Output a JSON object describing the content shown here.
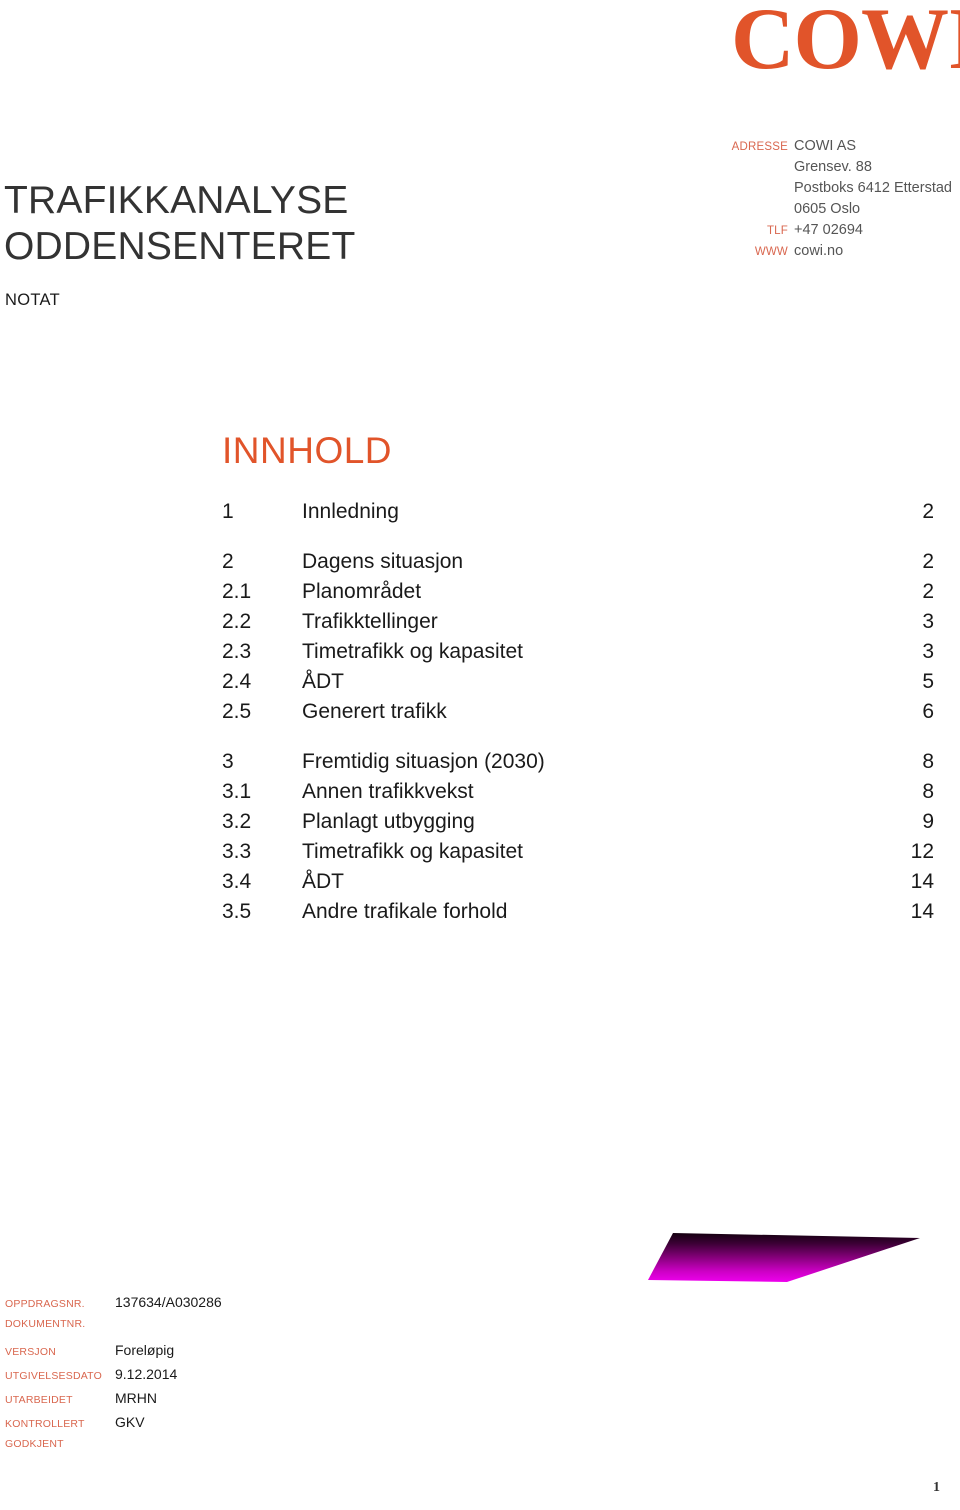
{
  "brand": {
    "logo_text": "COWI",
    "accent_color": "#E1542A",
    "label_color": "#D9674F"
  },
  "address": {
    "rows": [
      {
        "label": "ADRESSE",
        "value": "COWI AS"
      },
      {
        "label": "",
        "value": "Grensev. 88"
      },
      {
        "label": "",
        "value": "Postboks 6412 Etterstad"
      },
      {
        "label": "",
        "value": "0605 Oslo"
      },
      {
        "label": "TLF",
        "value": "+47 02694"
      },
      {
        "label": "WWW",
        "value": "cowi.no"
      }
    ]
  },
  "document": {
    "title_line1": "TRAFIKKANALYSE",
    "title_line2": "ODDENSENTERET",
    "subtitle": "NOTAT"
  },
  "toc": {
    "heading": "INNHOLD",
    "groups": [
      {
        "entries": [
          {
            "number": "1",
            "label": "Innledning",
            "page": "2"
          }
        ]
      },
      {
        "entries": [
          {
            "number": "2",
            "label": "Dagens situasjon",
            "page": "2"
          },
          {
            "number": "2.1",
            "label": "Planområdet",
            "page": "2"
          },
          {
            "number": "2.2",
            "label": "Trafikktellinger",
            "page": "3"
          },
          {
            "number": "2.3",
            "label": "Timetrafikk og kapasitet",
            "page": "3"
          },
          {
            "number": "2.4",
            "label": "ÅDT",
            "page": "5"
          },
          {
            "number": "2.5",
            "label": "Generert trafikk",
            "page": "6"
          }
        ]
      },
      {
        "entries": [
          {
            "number": "3",
            "label": "Fremtidig situasjon (2030)",
            "page": "8"
          },
          {
            "number": "3.1",
            "label": "Annen trafikkvekst",
            "page": "8"
          },
          {
            "number": "3.2",
            "label": "Planlagt utbygging",
            "page": "9"
          },
          {
            "number": "3.3",
            "label": "Timetrafikk og kapasitet",
            "page": "12"
          },
          {
            "number": "3.4",
            "label": "ÅDT",
            "page": "14"
          },
          {
            "number": "3.5",
            "label": "Andre trafikale forhold",
            "page": "14"
          }
        ]
      }
    ]
  },
  "decoration": {
    "name": "magenta-polygon",
    "gradient_top_color": "#1a0010",
    "gradient_bottom_color": "#E800E8"
  },
  "meta": {
    "rows": [
      {
        "label": "OPPDRAGSNR.",
        "value": "137634/A030286"
      },
      {
        "label": "DOKUMENTNR.",
        "value": ""
      },
      {
        "label": "VERSJON",
        "value": "Foreløpig"
      },
      {
        "label": "UTGIVELSESDATO",
        "value": "9.12.2014"
      },
      {
        "label": "UTARBEIDET",
        "value": "MRHN"
      },
      {
        "label": "KONTROLLERT",
        "value": "GKV"
      },
      {
        "label": "GODKJENT",
        "value": ""
      }
    ]
  },
  "footer": {
    "page_number": "1"
  }
}
